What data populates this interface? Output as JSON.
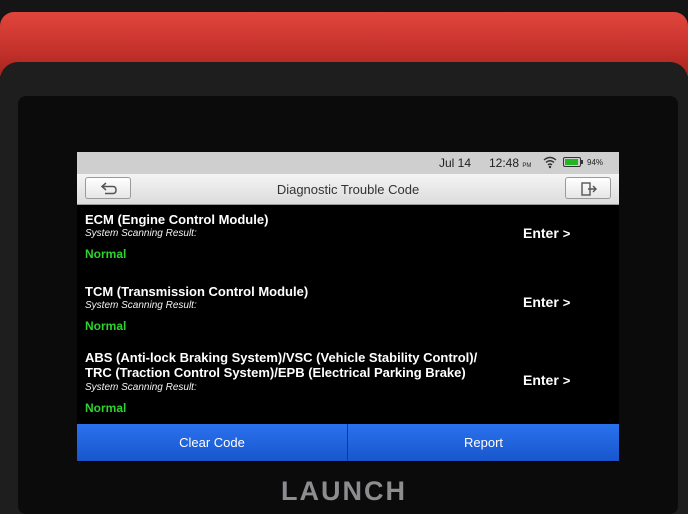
{
  "status_bar": {
    "date": "Jul 14",
    "time": "12:48",
    "ampm": "PM",
    "wifi_icon": "wifi-icon",
    "battery_icon": "battery-icon",
    "battery_percent": "94%",
    "battery_level": 0.94,
    "battery_color": "#23b523"
  },
  "title_bar": {
    "title": "Diagnostic Trouble Code",
    "back_icon": "back-arrow-icon",
    "exit_icon": "exit-icon"
  },
  "systems": [
    {
      "name": "ECM (Engine Control Module)",
      "sub": "System Scanning Result:",
      "status": "Normal",
      "action": "Enter",
      "action_icon": ">"
    },
    {
      "name": "TCM (Transmission Control Module)",
      "sub": "System Scanning Result:",
      "status": "Normal",
      "action": "Enter",
      "action_icon": ">"
    },
    {
      "name": "ABS (Anti-lock Braking System)/VSC (Vehicle Stability Control)/ TRC (Traction Control System)/EPB (Electrical Parking Brake)",
      "sub": "System Scanning Result:",
      "status": "Normal",
      "action": "Enter",
      "action_icon": ">"
    }
  ],
  "status_color": "#2fd12f",
  "buttons": {
    "clear": "Clear Code",
    "report": "Report"
  },
  "accent_color": "#1a5fd9",
  "device": {
    "brand": "LAUNCH"
  }
}
